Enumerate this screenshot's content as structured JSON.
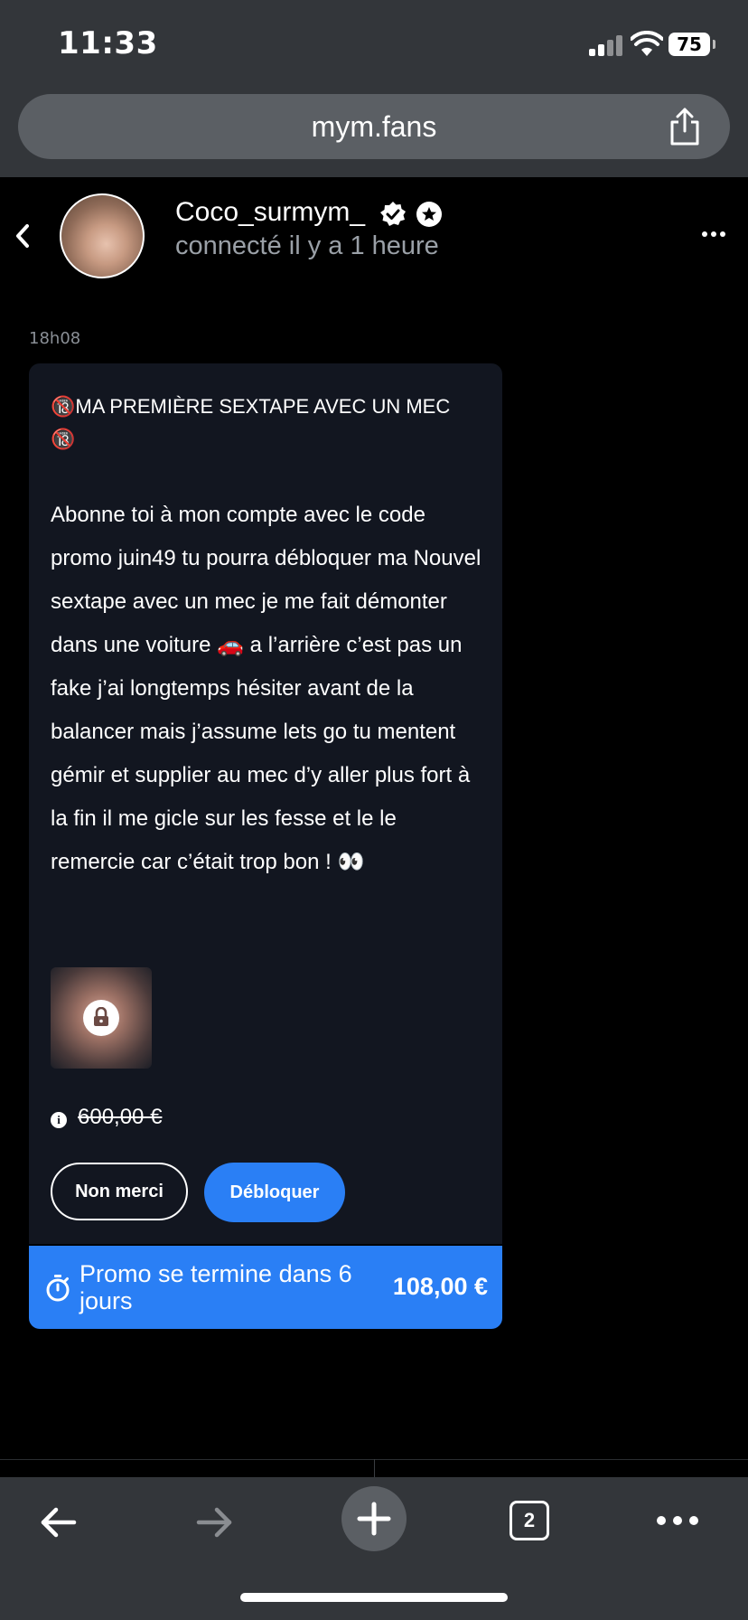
{
  "status": {
    "time": "11:33",
    "battery": "75"
  },
  "browser": {
    "url": "mym.fans",
    "tab_count": "2"
  },
  "profile": {
    "username": "Coco_surmym_",
    "last_seen": "connecté il y a 1 heure"
  },
  "message": {
    "timestamp": "18h08",
    "title": "🔞MA PREMIÈRE SEXTAPE AVEC UN MEC 🔞",
    "body": "Abonne toi à mon compte avec le code promo juin49 tu pourra débloquer ma Nouvel sextape avec un mec je me fait démonter dans une voiture 🚗 a l’arrière c’est pas un fake j’ai longtemps hésiter avant de la balancer mais j’assume lets go tu mentent gémir et supplier au mec d’y aller plus fort à la fin il me gicle sur les fesse et le le remercie car c’était trop bon ! 👀",
    "old_price": "600,00 €",
    "decline_label": "Non merci",
    "unlock_label": "Débloquer"
  },
  "promo": {
    "text": "Promo se termine dans 6 jours",
    "price": "108,00 €"
  },
  "colors": {
    "accent": "#2a7ff5",
    "card_bg": "#121620",
    "browser_chrome": "#33363a"
  },
  "icons": [
    "back-chevron-icon",
    "verified-icon",
    "star-badge-icon",
    "more-icon",
    "lock-icon",
    "info-icon",
    "timer-icon",
    "share-icon",
    "arrow-left-icon",
    "arrow-right-icon",
    "plus-icon",
    "tabs-icon",
    "dots-icon"
  ]
}
